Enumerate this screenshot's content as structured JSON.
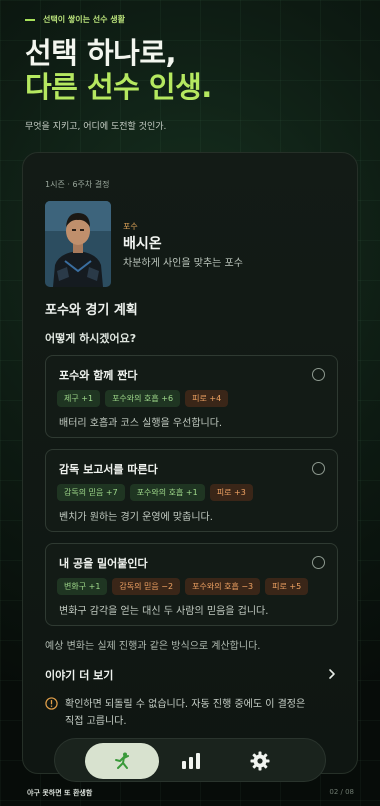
{
  "hero": {
    "eyebrow": "선택이 쌓이는 선수 생활",
    "title_line1": "선택 하나로,",
    "title_line2": "다른 선수 인생.",
    "subtitle": "무엇을 지키고, 어디에 도전할 것인가."
  },
  "card": {
    "meta": "1시즌 · 6주차 결정",
    "player": {
      "position_tag": "포수",
      "name": "배시온",
      "description": "차분하게 사인을 맞추는 포수"
    },
    "section_title": "포수와 경기 계획",
    "question": "어떻게 하시겠어요?",
    "options": [
      {
        "title": "포수와 함께 짠다",
        "chips": [
          {
            "label": "제구 +1",
            "tone": "positive"
          },
          {
            "label": "포수와의 호흡 +6",
            "tone": "positive"
          },
          {
            "label": "피로 +4",
            "tone": "negative"
          }
        ],
        "description": "배터리 호흡과 코스 실행을 우선합니다."
      },
      {
        "title": "감독 보고서를 따른다",
        "chips": [
          {
            "label": "감독의 믿음 +7",
            "tone": "positive"
          },
          {
            "label": "포수와의 호흡 +1",
            "tone": "positive"
          },
          {
            "label": "피로 +3",
            "tone": "negative"
          }
        ],
        "description": "벤치가 원하는 경기 운영에 맞춥니다."
      },
      {
        "title": "내 공을 밀어붙인다",
        "chips": [
          {
            "label": "변화구 +1",
            "tone": "positive"
          },
          {
            "label": "감독의 믿음 −2",
            "tone": "negative"
          },
          {
            "label": "포수와의 호흡 −3",
            "tone": "negative"
          },
          {
            "label": "피로 +5",
            "tone": "negative"
          }
        ],
        "description": "변화구 감각을 얻는 대신 두 사람의 믿음을 겁니다."
      }
    ],
    "note": "예상 변화는 실제 진행과 같은 방식으로 계산합니다.",
    "more_label": "이야기 더 보기",
    "warning_line1": "확인하면 되돌릴 수 없습니다. 자동 진행 중에도 이 결정은",
    "warning_line2": "직접 고릅니다."
  },
  "tabbar": {
    "tabs": [
      {
        "icon": "pitcher-icon",
        "active": true
      },
      {
        "icon": "bar-chart-icon",
        "active": false
      },
      {
        "icon": "gear-icon",
        "active": false
      }
    ]
  },
  "footer": {
    "left": "야구 못하면 또 환생함",
    "right": "02 / 08"
  },
  "colors": {
    "accent": "#b5e860",
    "positive": "#9fd98b",
    "negative": "#f0a363",
    "card_bg": "#131b16"
  }
}
